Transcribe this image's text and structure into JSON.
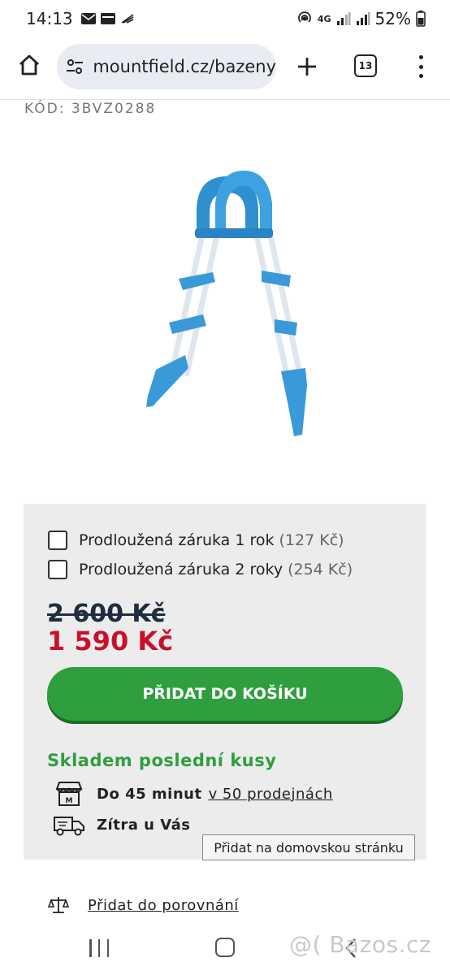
{
  "status_bar": {
    "time": "14:13",
    "network": "4G",
    "battery": "52%"
  },
  "browser": {
    "url": "mountfield.cz/bazeny",
    "tab_count": "13"
  },
  "product": {
    "code": "KÓD: 3BVZ0288"
  },
  "purchase": {
    "options": [
      {
        "label": "Prodloužená záruka 1 rok",
        "price": "(127 Kč)"
      },
      {
        "label": "Prodloužená záruka 2 roky",
        "price": "(254 Kč)"
      }
    ],
    "old_price": "2 600 Kč",
    "new_price": "1 590 Kč",
    "add_to_cart": "PŘIDAT DO KOŠÍKU",
    "stock": "Skladem poslední kusy",
    "store_pickup_time": "Do 45 minut",
    "store_pickup_link": "v 50 prodejnách",
    "delivery_text": "Zítra u Vás"
  },
  "tooltip": "Přidat na domovskou stránku",
  "compare": "Přidat do porovnání",
  "watermark": "@( Bazos.cz",
  "colors": {
    "accent_green": "#2f9e3e",
    "price_red": "#c8102e",
    "product_blue": "#3a9ad9"
  }
}
